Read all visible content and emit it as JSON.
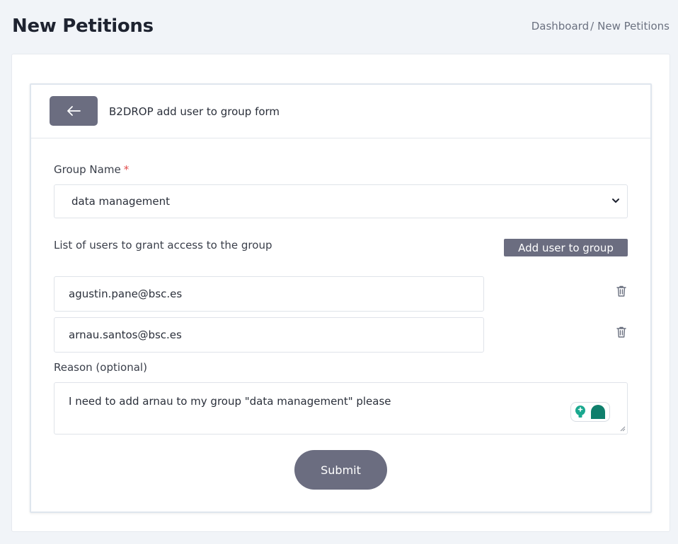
{
  "header": {
    "title": "New Petitions",
    "breadcrumb": {
      "root": "Dashboard",
      "separator": "/",
      "current": "New Petitions"
    }
  },
  "form": {
    "title": "B2DROP add user to group form",
    "group_label": "Group Name",
    "required_mark": "*",
    "group_value": "data management",
    "users_label": "List of users to grant access to the group",
    "add_user_label": "Add user to group",
    "users": [
      {
        "email": "agustin.pane@bsc.es"
      },
      {
        "email": "arnau.santos@bsc.es"
      }
    ],
    "reason_label": "Reason (optional)",
    "reason_value": "I need to add arnau to my group \"data management\" please",
    "submit_label": "Submit"
  },
  "colors": {
    "button": "#6b6d80",
    "required": "#e24b4b",
    "page_bg": "#f1f4f8",
    "widget_accent": "#1aa88f"
  },
  "icons": {
    "back": "arrow-left-icon",
    "delete": "trash-icon",
    "select": "chevron-down-icon"
  }
}
